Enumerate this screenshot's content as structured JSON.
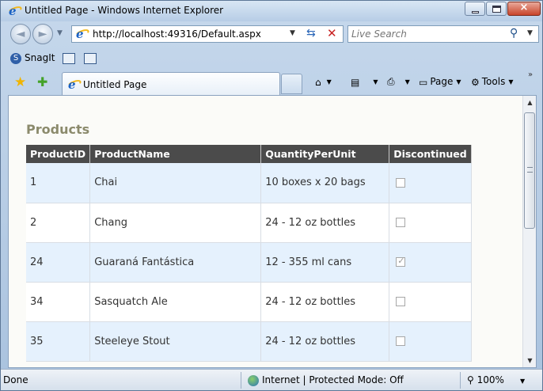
{
  "window": {
    "title": "Untitled Page - Windows Internet Explorer",
    "close_glyph": "×"
  },
  "navigation": {
    "back_glyph": "◄",
    "forward_glyph": "►",
    "address": "http://localhost:49316/Default.aspx",
    "search_placeholder": "Live Search"
  },
  "links_bar": {
    "snagit_label": "SnagIt"
  },
  "tabs": [
    {
      "label": "Untitled Page",
      "active": true
    }
  ],
  "command_bar": {
    "page_label": "Page",
    "tools_label": "Tools"
  },
  "page": {
    "heading": "Products",
    "grid": {
      "columns": [
        "ProductID",
        "ProductName",
        "QuantityPerUnit",
        "Discontinued"
      ],
      "rows": [
        {
          "id": "1",
          "name": "Chai",
          "quantity": "10 boxes x 20 bags",
          "discontinued": false
        },
        {
          "id": "2",
          "name": "Chang",
          "quantity": "24 - 12 oz bottles",
          "discontinued": false
        },
        {
          "id": "24",
          "name": "Guaraná Fantástica",
          "quantity": "12 - 355 ml cans",
          "discontinued": true
        },
        {
          "id": "34",
          "name": "Sasquatch Ale",
          "quantity": "24 - 12 oz bottles",
          "discontinued": false
        },
        {
          "id": "35",
          "name": "Steeleye Stout",
          "quantity": "24 - 12 oz bottles",
          "discontinued": false
        }
      ]
    }
  },
  "status_bar": {
    "status": "Done",
    "zone": "Internet | Protected Mode: Off",
    "zoom": "100%"
  },
  "icons": {
    "browser": "ie-logo-icon",
    "favorites": "star-icon",
    "add_favorite": "add-favorite-icon",
    "home": "home-icon",
    "feeds": "feeds-icon",
    "print": "print-icon",
    "page": "page-icon",
    "tools": "gear-icon",
    "refresh": "refresh-icon",
    "stop": "stop-icon",
    "search": "search-icon",
    "zone": "globe-icon",
    "zoom": "zoom-icon"
  },
  "colors": {
    "grid_header": "#4b4b4b",
    "row_alt": "#e5f1fd",
    "heading": "#8b8a6c",
    "link_blue": "#1b62c5"
  }
}
